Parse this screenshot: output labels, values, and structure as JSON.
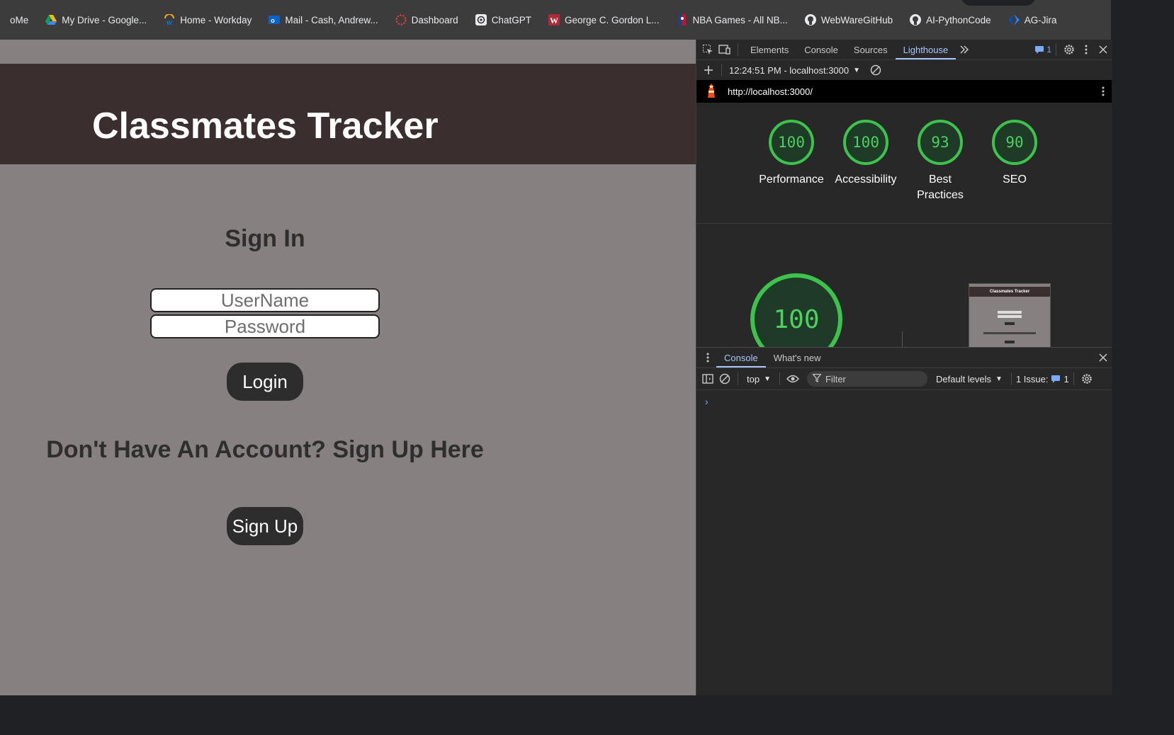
{
  "bookmarks": [
    {
      "label": "oMe",
      "icon": "none"
    },
    {
      "label": "My Drive - Google...",
      "icon": "google-drive-icon"
    },
    {
      "label": "Home - Workday",
      "icon": "workday-icon"
    },
    {
      "label": "Mail - Cash, Andrew...",
      "icon": "outlook-icon"
    },
    {
      "label": "Dashboard",
      "icon": "dashboard-icon"
    },
    {
      "label": "ChatGPT",
      "icon": "chatgpt-icon"
    },
    {
      "label": "George C. Gordon L...",
      "icon": "wpi-icon"
    },
    {
      "label": "NBA Games - All NB...",
      "icon": "nba-icon"
    },
    {
      "label": "WebWareGitHub",
      "icon": "github-icon"
    },
    {
      "label": "AI-PythonCode",
      "icon": "github-icon"
    },
    {
      "label": "AG-Jira",
      "icon": "jira-icon"
    }
  ],
  "app": {
    "title": "Classmates Tracker",
    "signin_heading": "Sign In",
    "username_placeholder": "UserName",
    "password_placeholder": "Password",
    "login_label": "Login",
    "signup_prompt": "Don't Have An Account? Sign Up Here",
    "signup_label": "Sign Up",
    "colors": {
      "header": "#3a2e2e",
      "background": "#878080",
      "button": "#2d2d2d"
    }
  },
  "devtools": {
    "tabs": [
      "Elements",
      "Console",
      "Sources",
      "Lighthouse"
    ],
    "active_tab": "Lighthouse",
    "issues_badge": "1",
    "report_selector": "12:24:51 PM - localhost:3000",
    "url": "http://localhost:3000/",
    "scores": [
      {
        "value": "100",
        "label": "Performance"
      },
      {
        "value": "100",
        "label": "Accessibility"
      },
      {
        "value": "93",
        "label": "Best Practices"
      },
      {
        "value": "90",
        "label": "SEO"
      }
    ],
    "big_score": "100",
    "thumbnail_title": "Classmates Tracker",
    "score_color": "#3cc24d",
    "drawer_tabs": [
      "Console",
      "What's new"
    ],
    "console": {
      "context": "top",
      "filter_placeholder": "Filter",
      "levels": "Default levels",
      "issues_text": "1 Issue:",
      "issues_count": "1",
      "prompt": "›"
    }
  }
}
